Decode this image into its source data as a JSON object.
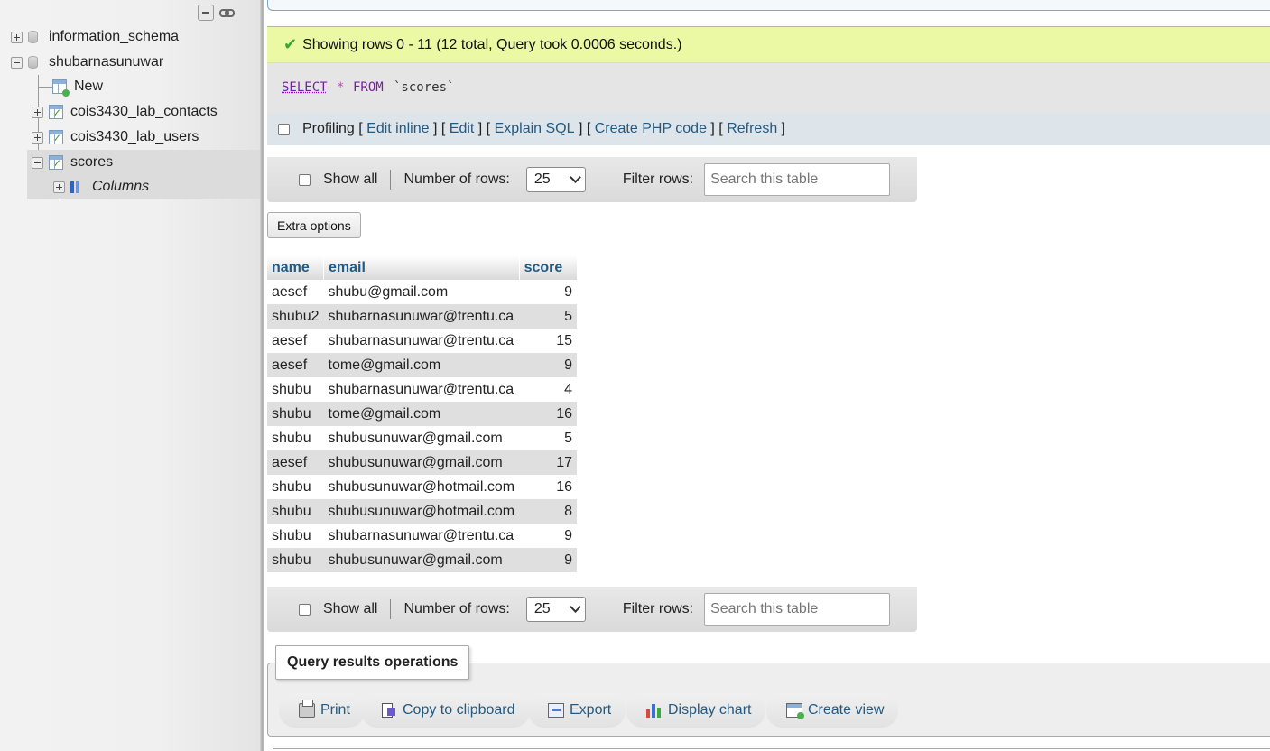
{
  "sidebar": {
    "databases": [
      {
        "name": "information_schema",
        "expanded": false
      },
      {
        "name": "shubarnasunuwar",
        "expanded": true
      }
    ],
    "tables": [
      {
        "label": "New",
        "kind": "new"
      },
      {
        "label": "cois3430_lab_contacts",
        "kind": "table"
      },
      {
        "label": "cois3430_lab_users",
        "kind": "table"
      },
      {
        "label": "scores",
        "kind": "table",
        "selected": true
      }
    ],
    "columns_label": "Columns"
  },
  "status": {
    "message": "Showing rows 0 - 11 (12 total, Query took 0.0006 seconds.)"
  },
  "sql": {
    "select": "SELECT",
    "star": "*",
    "from": "FROM",
    "table": "`scores`"
  },
  "profiling": {
    "label": "Profiling",
    "links": [
      "Edit inline",
      "Edit",
      "Explain SQL",
      "Create PHP code",
      "Refresh"
    ]
  },
  "navigation": {
    "show_all": "Show all",
    "rows_label": "Number of rows:",
    "rows_value": "25",
    "filter_label": "Filter rows:",
    "filter_placeholder": "Search this table"
  },
  "extra_options": "Extra options",
  "table": {
    "headers": [
      "name",
      "email",
      "score"
    ],
    "rows": [
      [
        "aesef",
        "shubu@gmail.com",
        "9"
      ],
      [
        "shubu2",
        "shubarnasunuwar@trentu.ca",
        "5"
      ],
      [
        "aesef",
        "shubarnasunuwar@trentu.ca",
        "15"
      ],
      [
        "aesef",
        "tome@gmail.com",
        "9"
      ],
      [
        "shubu",
        "shubarnasunuwar@trentu.ca",
        "4"
      ],
      [
        "shubu",
        "tome@gmail.com",
        "16"
      ],
      [
        "shubu",
        "shubusunuwar@gmail.com",
        "5"
      ],
      [
        "aesef",
        "shubusunuwar@gmail.com",
        "17"
      ],
      [
        "shubu",
        "shubusunuwar@hotmail.com",
        "16"
      ],
      [
        "shubu",
        "shubusunuwar@hotmail.com",
        "8"
      ],
      [
        "shubu",
        "shubarnasunuwar@trentu.ca",
        "9"
      ],
      [
        "shubu",
        "shubusunuwar@gmail.com",
        "9"
      ]
    ]
  },
  "operations": {
    "title": "Query results operations",
    "buttons": [
      "Print",
      "Copy to clipboard",
      "Export",
      "Display chart",
      "Create view"
    ]
  },
  "colors": {
    "link": "#235a81",
    "success_bg": "#ebf8a4",
    "sql_keyword": "#7a1fa2"
  }
}
